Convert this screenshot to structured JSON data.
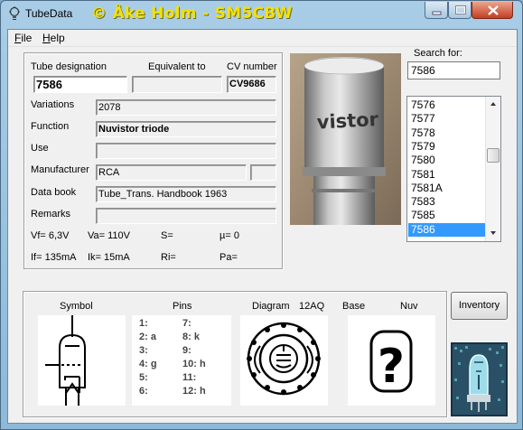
{
  "titlebar": {
    "app_name": "TubeData",
    "banner": "© Åke Holm - SM5CBW"
  },
  "menu": {
    "file": "File",
    "file_key": "F",
    "file_rest": "ile",
    "help": "Help",
    "help_key": "H",
    "help_rest": "elp"
  },
  "form": {
    "tube_designation_label": "Tube designation",
    "tube_designation": "7586",
    "equivalent_label": "Equivalent to",
    "equivalent": "",
    "cv_label": "CV number",
    "cv_number": "CV9686",
    "variations_label": "Variations",
    "variations": "2078",
    "function_label": "Function",
    "function": "Nuvistor triode",
    "use_label": "Use",
    "use": "",
    "manufacturer_label": "Manufacturer",
    "manufacturer": "RCA",
    "databook_label": "Data book",
    "databook": "Tube_Trans. Handbook 1963",
    "remarks_label": "Remarks",
    "remarks": ""
  },
  "electrical": {
    "vf": "Vf= 6,3V",
    "va": "Va= 110V",
    "s": "S=",
    "mu": "µ=   0",
    "if": "If= 135mA",
    "ik": "Ik=  15mA",
    "ri": "Ri=",
    "pa": "Pa="
  },
  "photo_text": "vistor",
  "search": {
    "label": "Search for:",
    "value": "7586"
  },
  "list": {
    "items": [
      "7576",
      "7577",
      "7578",
      "7579",
      "7580",
      "7581",
      "7581A",
      "7583",
      "7585",
      "7586"
    ],
    "selected_index": 9
  },
  "bottom": {
    "symbol_label": "Symbol",
    "pins_label": "Pins",
    "diagram_label": "Diagram",
    "diagram_code": "12AQ",
    "base_label": "Base",
    "base_code": "Nuv",
    "pins": [
      "1:",
      "2: a",
      "3:",
      "4: g",
      "5:",
      "6:",
      "7:",
      "8: k",
      "9:",
      "10: h",
      "11:",
      "12: h"
    ]
  },
  "buttons": {
    "inventory": "Inventory"
  },
  "colors": {
    "selection": "#3399ff",
    "banner": "#f3e200",
    "titlebar": "#a9cde6"
  }
}
